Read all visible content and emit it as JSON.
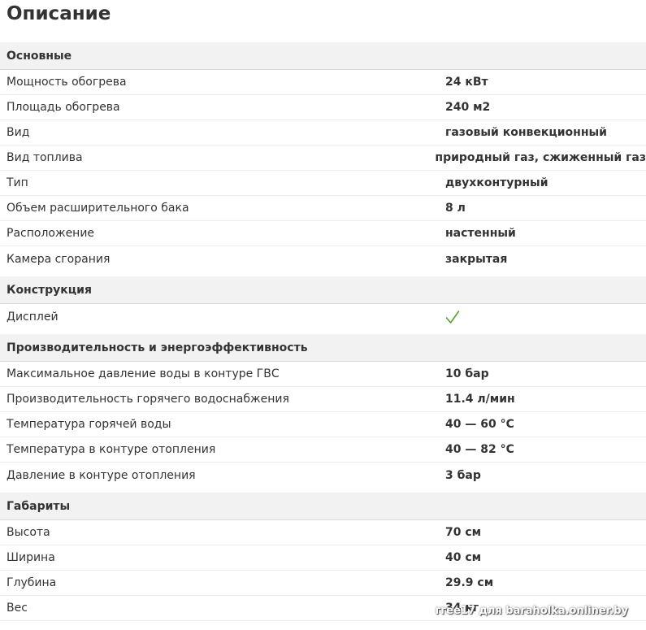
{
  "page_title": "Описание",
  "sections": [
    {
      "name": "Основные",
      "rows": [
        {
          "label": "Мощность обогрева",
          "value": "24 кВт"
        },
        {
          "label": "Площадь обогрева",
          "value": "240 м2"
        },
        {
          "label": "Вид",
          "value": "газовый конвекционный"
        },
        {
          "label": "Вид топлива",
          "value": "природный газ, сжиженный газ"
        },
        {
          "label": "Тип",
          "value": "двухконтурный"
        },
        {
          "label": "Объем расширительного бака",
          "value": "8 л"
        },
        {
          "label": "Расположение",
          "value": "настенный"
        },
        {
          "label": "Камера сгорания",
          "value": "закрытая"
        }
      ]
    },
    {
      "name": "Конструкция",
      "rows": [
        {
          "label": "Дисплей",
          "icon": "check-icon",
          "icon_color": "#5aa02c"
        }
      ]
    },
    {
      "name": "Производительность и энергоэффективность",
      "rows": [
        {
          "label": "Максимальное давление воды в контуре ГВС",
          "value": "10 бар"
        },
        {
          "label": "Производительность горячего водоснабжения",
          "value": "11.4 л/мин"
        },
        {
          "label": "Температура горячей воды",
          "value": "40 — 60 °С"
        },
        {
          "label": "Температура в контуре отопления",
          "value": "40 — 82 °С"
        },
        {
          "label": "Давление в контуре отопления",
          "value": "3 бар"
        }
      ]
    },
    {
      "name": "Габариты",
      "rows": [
        {
          "label": "Высота",
          "value": "70 см"
        },
        {
          "label": "Ширина",
          "value": "40 см"
        },
        {
          "label": "Глубина",
          "value": "29.9 см"
        },
        {
          "label": "Вес",
          "value": "34 кг"
        }
      ]
    }
  ],
  "watermark": "ггее17 для baraholka.onliner.by"
}
